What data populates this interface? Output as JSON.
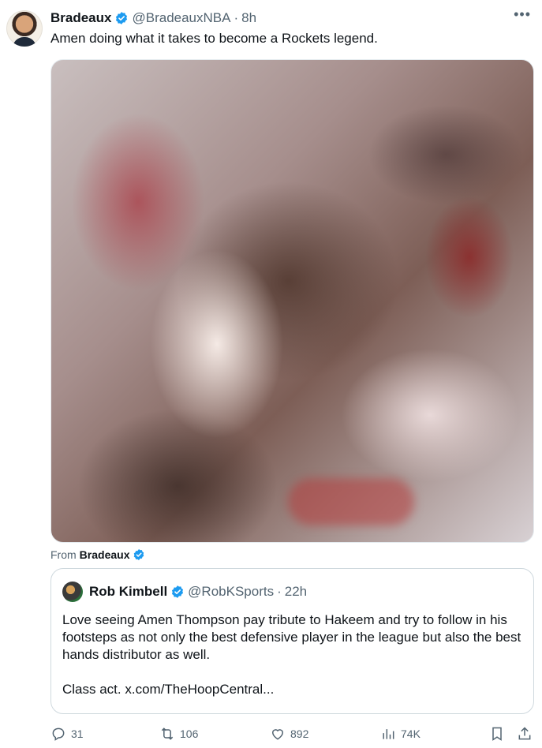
{
  "post": {
    "author_name": "Bradeaux",
    "author_handle": "@BradeauxNBA",
    "separator": "·",
    "time": "8h",
    "more_label": "•••",
    "text": "Amen doing what it takes to become a Rockets legend.",
    "media_icon": "video-thumbnail",
    "from_prefix": "From",
    "from_name": "Bradeaux"
  },
  "quoted": {
    "author_name": "Rob Kimbell",
    "author_handle": "@RobKSports",
    "separator": "·",
    "time": "22h",
    "text_line1": "Love seeing Amen Thompson pay tribute to Hakeem and try to follow in his footsteps as not only the best defensive player in the league but also the best hands distributor as well.",
    "text_line2": "Class act. x.com/TheHoopCentral..."
  },
  "actions": {
    "replies": "31",
    "reposts": "106",
    "likes": "892",
    "views": "74K"
  },
  "colors": {
    "verified_blue": "#1d9bf0",
    "secondary_text": "#536471",
    "border": "#cfd9de"
  }
}
